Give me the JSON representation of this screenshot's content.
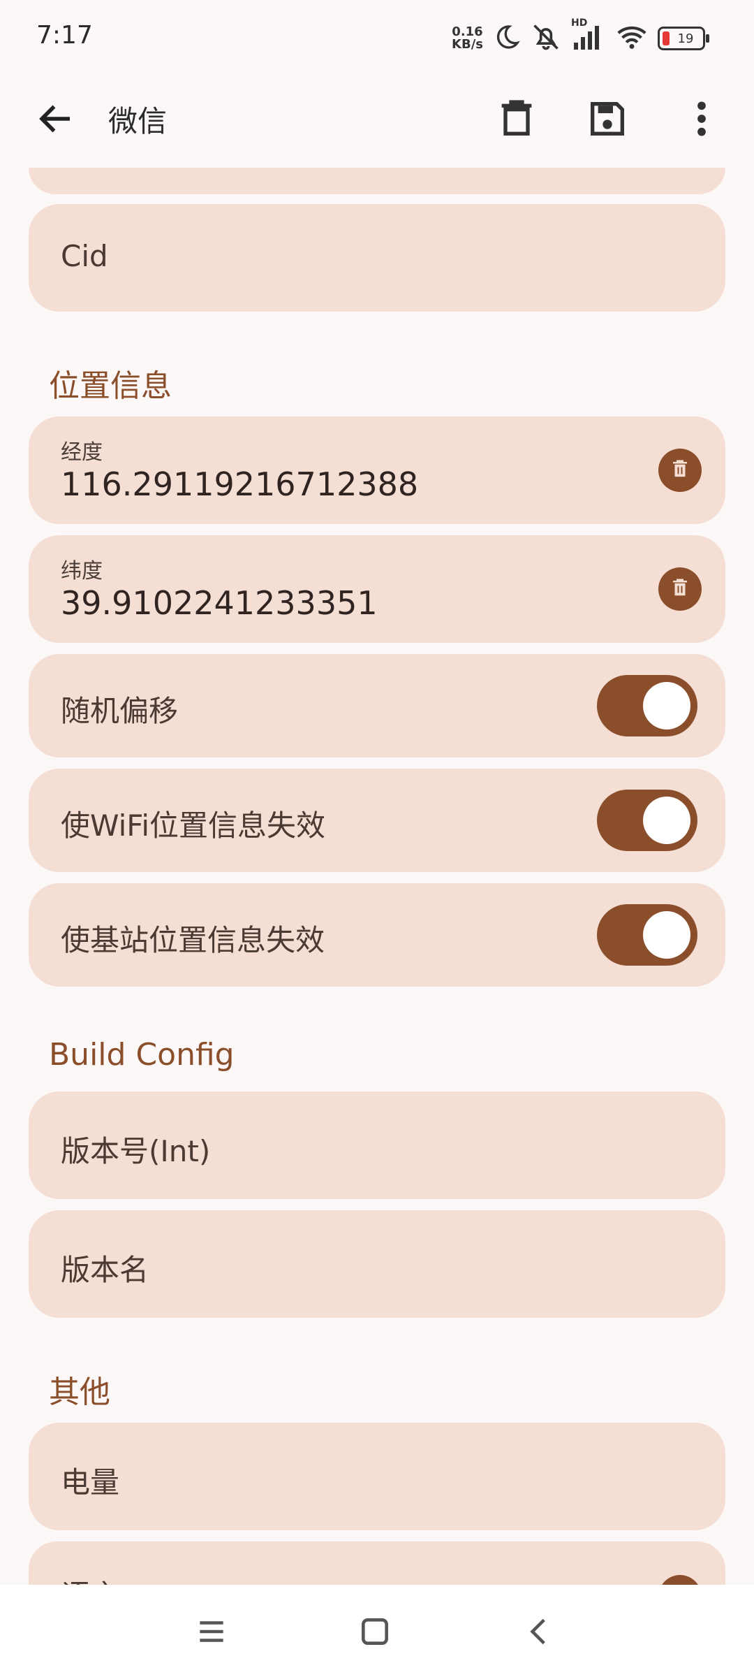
{
  "status_bar": {
    "time": "7:17",
    "net_speed_value": "0.16",
    "net_speed_unit": "KB/s",
    "hd_label": "HD",
    "battery_level": "19"
  },
  "app_bar": {
    "title": "微信",
    "icons": [
      "back-arrow-icon",
      "trash-icon",
      "save-icon",
      "more-vert-icon"
    ]
  },
  "fields_top": {
    "cid_label": "Cid"
  },
  "sections": {
    "location": "位置信息",
    "build_config": "Build Config",
    "other": "其他"
  },
  "location": {
    "longitude_label": "经度",
    "longitude_value": "116.29119216712388",
    "latitude_label": "纬度",
    "latitude_value": "39.9102241233351",
    "toggles": [
      {
        "label": "随机偏移",
        "on": true
      },
      {
        "label": "使WiFi位置信息失效",
        "on": true
      },
      {
        "label": "使基站位置信息失效",
        "on": true
      }
    ]
  },
  "build_config": {
    "version_code_label": "版本号(Int)",
    "version_name_label": "版本名"
  },
  "other": {
    "battery_label": "电量",
    "partial_label": "语言"
  },
  "colors": {
    "accent": "#8a4e2a",
    "card": "#f5ded3",
    "background": "#fdf8f8"
  }
}
